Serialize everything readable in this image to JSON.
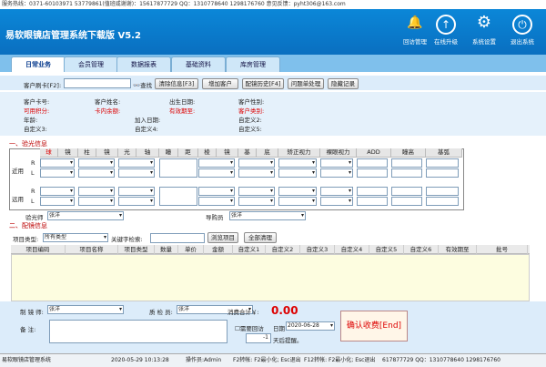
{
  "topbar": "服务热线：0371-60103971 53779861(值班咸谢谢)：15617877729  QQ：1310778640 1298176760  意见反馈：pyht306@163.com",
  "title": "易软眼镜店管理系统下载版  V5.2",
  "header_buttons": [
    {
      "label": "回访管理",
      "icon": "bell-icon"
    },
    {
      "label": "在线升级",
      "icon": "arrow-up-icon"
    },
    {
      "label": "系统设置",
      "icon": "gear-icon"
    },
    {
      "label": "退出系统",
      "icon": "power-icon"
    }
  ],
  "tabs": [
    "日常业务",
    "会员管理",
    "数据报表",
    "基础资料",
    "库房管理"
  ],
  "search": {
    "card_label": "客户刷卡[F2]:",
    "query": "查找",
    "buttons": [
      "清除信息[F3]",
      "增加客户",
      "配镜历史[F4]",
      "问题单处理",
      "隐藏记录"
    ]
  },
  "info": {
    "row1": [
      "客户卡号:",
      "客户姓名:",
      "出生日期:",
      "客户性别:"
    ],
    "row2": [
      "可用积分:",
      "卡内余额:",
      "有效期至:",
      "客户类别:"
    ],
    "row3": [
      "年龄:",
      "加入日期:",
      "自定义2:"
    ],
    "row4": [
      "自定义3:",
      "自定义4:",
      "自定义5:"
    ]
  },
  "exam": {
    "title": "一、验光信息",
    "cols": [
      "球",
      "镜",
      "柱",
      "镜",
      "光",
      "轴",
      "瞳",
      "距",
      "棱",
      "镜",
      "基",
      "底",
      "矫正视力",
      "裸眼视力",
      "ADD",
      "瞳高",
      "基弧"
    ],
    "near": "近用",
    "far": "远用",
    "R": "R",
    "L": "L",
    "optometrist_label": "验光师",
    "optometrist": "张洋",
    "guide_label": "导购员",
    "guide": "张洋"
  },
  "order": {
    "title": "二、配镜信息",
    "type_label": "项目类型:",
    "type_value": "所有类型",
    "kw_label": "关键字检索:",
    "browse": "浏览项目",
    "clear": "全部清理",
    "cols": [
      "项目编码",
      "项目名称",
      "项目类型",
      "数量",
      "单价",
      "金额",
      "自定义1",
      "自定义2",
      "自定义3",
      "自定义4",
      "自定义5",
      "自定义6",
      "有效期至",
      "批号"
    ]
  },
  "bottom": {
    "maker_label": "制 镜 师:",
    "maker": "张洋",
    "qc_label": "质 检 员:",
    "qc": "张洋",
    "total_label": "消费合计￥:",
    "total": "0.00",
    "remark_label": "备    注:",
    "revisit": "需要回访",
    "date_label": "日期",
    "date": "2020-06-28",
    "days": "-1",
    "days_label": "天后提醒。",
    "confirm": "确认收费[End]"
  },
  "status": [
    "易软眼镜店管理系统",
    "2020-05-29 10:13:28",
    "操作员:Admin",
    "F2转帐: F2最小化; Esc退出",
    "F12转帐: F2最小化; Esc退出",
    "617877729  QQ：1310778640 1298176760"
  ]
}
